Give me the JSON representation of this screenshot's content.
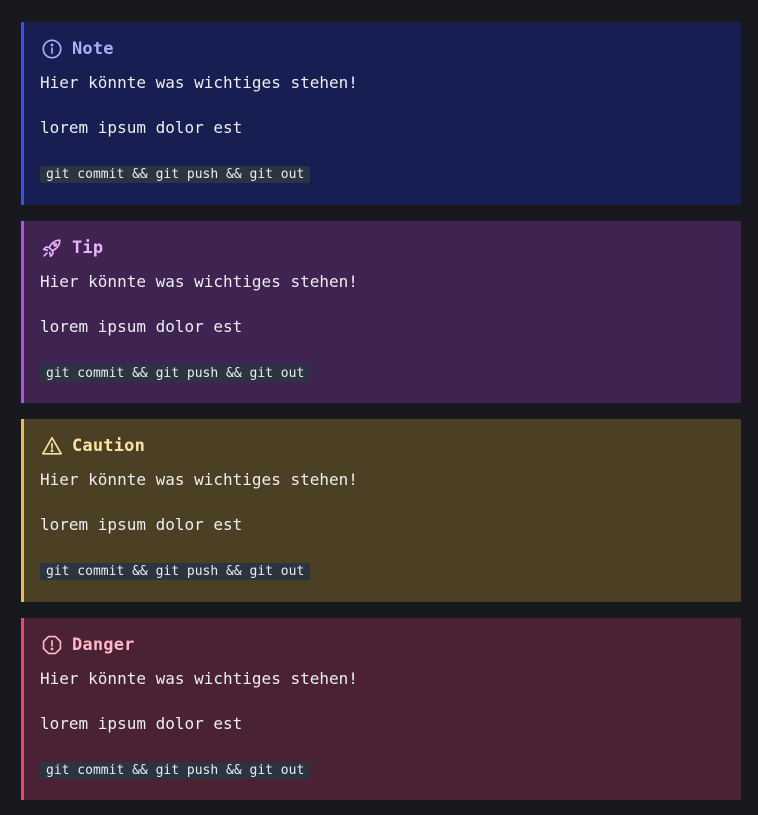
{
  "asides": [
    {
      "type": "note",
      "title": "Note",
      "icon": "info-circle-icon",
      "text_1": "Hier könnte was wichtiges stehen!",
      "text_2": "lorem ipsum dolor est",
      "code": "git commit && git push && git out",
      "accent": "#3c4ef0",
      "background": "#171e51"
    },
    {
      "type": "tip",
      "title": "Tip",
      "icon": "rocket-icon",
      "text_1": "Hier könnte was wichtiges stehen!",
      "text_2": "lorem ipsum dolor est",
      "code": "git commit && git push && git out",
      "accent": "#b251e2",
      "background": "#3f2351"
    },
    {
      "type": "caution",
      "title": "Caution",
      "icon": "warning-triangle-icon",
      "text_1": "Hier könnte was wichtiges stehen!",
      "text_2": "lorem ipsum dolor est",
      "code": "git commit && git push && git out",
      "accent": "#e7c04a",
      "background": "#4b4024"
    },
    {
      "type": "danger",
      "title": "Danger",
      "icon": "alert-octagon-icon",
      "text_1": "Hier könnte was wichtiges stehen!",
      "text_2": "lorem ipsum dolor est",
      "code": "git commit && git push && git out",
      "accent": "#e24b77",
      "background": "#4b2233"
    }
  ]
}
